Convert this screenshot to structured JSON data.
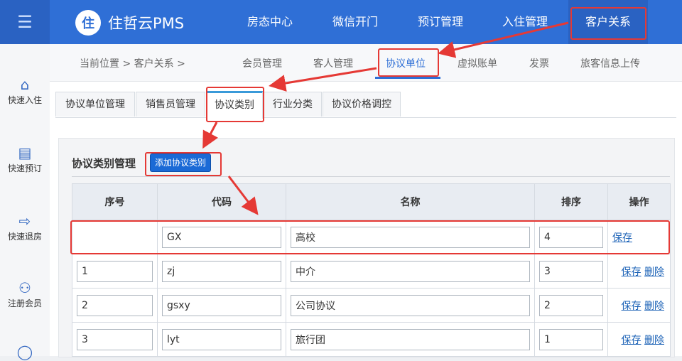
{
  "app": {
    "logo_text": "住哲云PMS"
  },
  "top_nav": [
    "房态中心",
    "微信开门",
    "预订管理",
    "入住管理",
    "客户关系"
  ],
  "sidebar": [
    {
      "label": "快速入住",
      "icon": "home-icon"
    },
    {
      "label": "快速预订",
      "icon": "document-icon"
    },
    {
      "label": "快速退房",
      "icon": "exit-icon"
    },
    {
      "label": "注册会员",
      "icon": "add-user-icon"
    }
  ],
  "breadcrumb": "当前位置 > 客户关系 >",
  "sub_nav": [
    "会员管理",
    "客人管理",
    "协议单位",
    "虚拟账单",
    "发票",
    "旅客信息上传"
  ],
  "tabs": [
    "协议单位管理",
    "销售员管理",
    "协议类别",
    "行业分类",
    "协议价格调控"
  ],
  "panel": {
    "title": "协议类别管理",
    "add_button": "添加协议类别"
  },
  "table": {
    "headers": [
      "序号",
      "代码",
      "名称",
      "排序",
      "操作"
    ],
    "rows": [
      {
        "no": "",
        "code": "GX",
        "name": "高校",
        "sort": "4",
        "actions": [
          "保存"
        ]
      },
      {
        "no": "1",
        "code": "zj",
        "name": "中介",
        "sort": "3",
        "actions": [
          "保存",
          "删除"
        ]
      },
      {
        "no": "2",
        "code": "gsxy",
        "name": "公司协议",
        "sort": "2",
        "actions": [
          "保存",
          "删除"
        ]
      },
      {
        "no": "3",
        "code": "lyt",
        "name": "旅行团",
        "sort": "1",
        "actions": [
          "保存",
          "删除"
        ]
      }
    ]
  },
  "colors": {
    "header_blue": "#2f6fd6",
    "annotation_red": "#e53935",
    "button_blue": "#1a6ad6",
    "link_blue": "#1d63b7"
  }
}
